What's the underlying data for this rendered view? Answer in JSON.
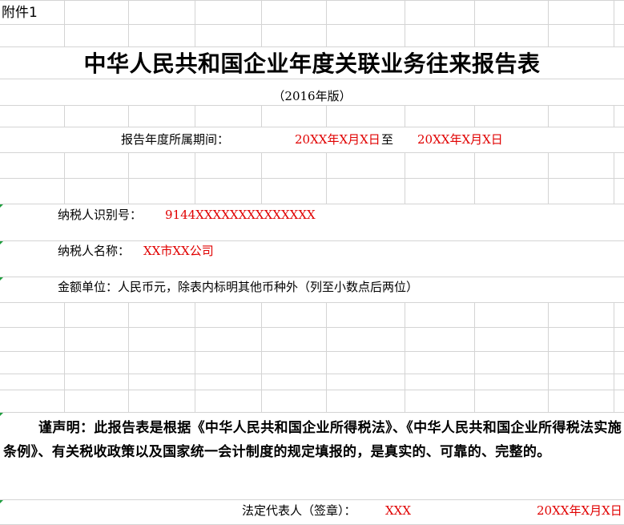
{
  "attachment_label": "附件1",
  "title": "中华人民共和国企业年度关联业务往来报告表",
  "edition": "（2016年版）",
  "report_period": {
    "label": "报告年度所属期间：",
    "start": "20XX年X月X日",
    "separator": "至",
    "end": "20XX年X月X日"
  },
  "taxpayer_id": {
    "label": "纳税人识别号：",
    "value": "9144XXXXXXXXXXXXXX"
  },
  "taxpayer_name": {
    "label": "纳税人名称：",
    "value": "XX市XX公司"
  },
  "currency_note": "金额单位：人民币元，除表内标明其他币种外（列至小数点后两位）",
  "declaration": "谨声明：此报告表是根据《中华人民共和国企业所得税法》、《中华人民共和国企业所得税法实施条例》、有关税收政策以及国家统一会计制度的规定填报的，是真实的、可靠的、完整的。",
  "signature": {
    "label": "法定代表人（签章）：",
    "value": "XXX",
    "date": "20XX年X月X日"
  },
  "colors": {
    "highlight_text": "#e00000",
    "gridline": "#d4d4d4",
    "cell_marker": "#1e9e3e"
  }
}
